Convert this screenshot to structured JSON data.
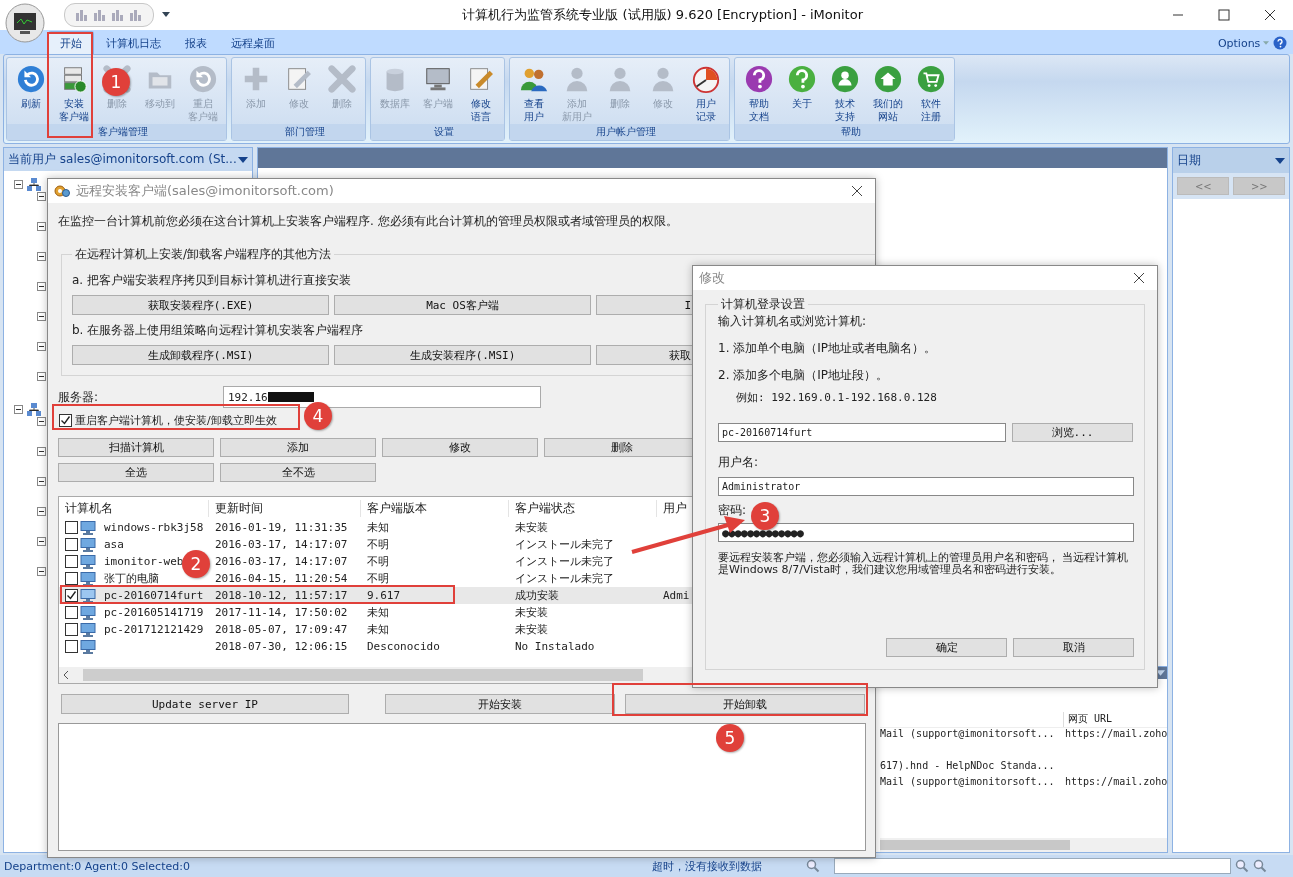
{
  "window": {
    "title": "计算机行为监管系统专业版 (试用版) 9.620 [Encryption] - iMonitor"
  },
  "tabs": [
    {
      "label": "开始",
      "selected": true
    },
    {
      "label": "计算机日志",
      "selected": false
    },
    {
      "label": "报表",
      "selected": false
    },
    {
      "label": "远程桌面",
      "selected": false
    }
  ],
  "options_menu": {
    "label": "Options"
  },
  "ribbon": [
    {
      "label": "客户端管理",
      "buttons": [
        {
          "label": "刷新",
          "disabled": false
        },
        {
          "label": "安装客户端",
          "disabled": false
        },
        {
          "label": "删除",
          "disabled": true
        },
        {
          "label": "移动到",
          "disabled": true
        },
        {
          "label": "重启客户端",
          "disabled": true
        }
      ]
    },
    {
      "label": "部门管理",
      "buttons": [
        {
          "label": "添加",
          "disabled": true
        },
        {
          "label": "修改",
          "disabled": true
        },
        {
          "label": "删除",
          "disabled": true
        }
      ]
    },
    {
      "label": "设置",
      "buttons": [
        {
          "label": "数据库",
          "disabled": true
        },
        {
          "label": "客户端",
          "disabled": true
        },
        {
          "label": "修改语言",
          "disabled": false
        }
      ]
    },
    {
      "label": "用户帐户管理",
      "buttons": [
        {
          "label": "查看用户",
          "disabled": false
        },
        {
          "label": "添加新用户",
          "disabled": true
        },
        {
          "label": "删除",
          "disabled": true
        },
        {
          "label": "修改",
          "disabled": true
        },
        {
          "label": "用户记录",
          "disabled": false
        }
      ]
    },
    {
      "label": "帮助",
      "buttons": [
        {
          "label": "帮助文档",
          "disabled": false
        },
        {
          "label": "关于",
          "disabled": false
        },
        {
          "label": "技术支持",
          "disabled": false
        },
        {
          "label": "我们的网站",
          "disabled": false
        },
        {
          "label": "软件注册",
          "disabled": false
        }
      ]
    }
  ],
  "current_user": "当前用户 sales@imonitorsoft.com (St...",
  "log_pane": {
    "column": "网页 URL",
    "rows": [
      {
        "column_1": "Mail (support@imonitorsoft...",
        "url": "https://mail.zoho"
      },
      {},
      {
        "column_1": "617).hnd - HelpNDoc Standa..."
      },
      {
        "column_1": "Mail (support@imonitorsoft...",
        "url": "https://mail.zoho"
      }
    ]
  },
  "date_panel": {
    "title": "日期",
    "prev": "<<",
    "next": ">>"
  },
  "status_bar": {
    "counts": "Department:0 Agent:0 Selected:0",
    "message": "超时，没有接收到数据"
  },
  "install_dialog": {
    "title": "远程安装客户端(sales@imonitorsoft.com)",
    "intro": "在监控一台计算机前您必须在这台计算机上安装客户端程序. 您必须有此台计算机的管理员权限或者域管理员的权限。",
    "group_title": "在远程计算机上安装/卸载客户端程序的其他方法",
    "method_a": "a. 把客户端安装程序拷贝到目标计算机进行直接安装",
    "method_a_buttons": [
      "获取安装程序(.EXE)",
      "Mac OS客户端",
      "I"
    ],
    "method_b": "b. 在服务器上使用组策略向远程计算机安装客户端程序",
    "method_b_buttons": [
      "生成卸载程序(.MSI)",
      "生成安装程序(.MSI)",
      "获取"
    ],
    "server_label": "服务器:",
    "server_value": "192.16",
    "restart": {
      "label": "重启客户端计算机，使安装/卸载立即生效",
      "checked": true
    },
    "action_buttons": [
      "扫描计算机",
      "添加",
      "修改",
      "删除"
    ],
    "select_buttons": [
      "全选",
      "全不选"
    ],
    "table": {
      "columns": [
        "计算机名",
        "更新时间",
        "客户端版本",
        "客户端状态",
        "用户"
      ],
      "rows": [
        {
          "checked": false,
          "selected": false,
          "name": "windows-rbk3j58",
          "updated": "2016-01-19, 11:31:35",
          "version": "未知",
          "status": "未安装"
        },
        {
          "checked": false,
          "selected": false,
          "name": "asa",
          "updated": "2016-03-17, 14:17:07",
          "version": "不明",
          "status": "インストール未完了"
        },
        {
          "checked": false,
          "selected": false,
          "name": "imonitor-web",
          "updated": "2016-03-17, 14:17:07",
          "version": "不明",
          "status": "インストール未完了"
        },
        {
          "checked": false,
          "selected": false,
          "name": "张丁的电脑",
          "updated": "2016-04-15, 11:20:54",
          "version": "不明",
          "status": "インストール未完了"
        },
        {
          "checked": true,
          "selected": true,
          "name": "pc-20160714furt",
          "updated": "2018-10-12, 11:57:17",
          "version": "9.617",
          "status": "成功安装",
          "user": "Admi"
        },
        {
          "checked": false,
          "selected": false,
          "name": "pc-201605141719",
          "updated": "2017-11-14, 17:50:02",
          "version": "未知",
          "status": "未安装"
        },
        {
          "checked": false,
          "selected": false,
          "name": "pc-201712121429",
          "updated": "2018-05-07, 17:09:47",
          "version": "未知",
          "status": "未安装"
        },
        {
          "checked": false,
          "selected": false,
          "updated": "2018-07-30, 12:06:15",
          "version": "Desconocido",
          "status": "No Instalado"
        }
      ]
    },
    "bottom_buttons": [
      "Update server IP",
      "开始安装",
      "开始卸载"
    ]
  },
  "edit_dialog": {
    "title": "修改",
    "group_title": "计算机登录设置",
    "prompt": "输入计算机名或浏览计算机:",
    "hint_1": "1. 添加单个电脑（IP地址或者电脑名）。",
    "hint_2": "2. 添加多个电脑（IP地址段）。",
    "example": "例如: 192.169.0.1-192.168.0.128",
    "computer_value": "pc-20160714furt",
    "browse": "浏览...",
    "username_label": "用户名:",
    "username_value": "Administrator",
    "password_label": "密码:",
    "password_value": "●●●●●●●●●●●●●",
    "note": "要远程安装客户端，您必须输入远程计算机上的管理员用户名和密码， 当远程计算机是Windows 8/7/Vista时，我们建议您用域管理员名和密码进行安装。",
    "buttons": [
      "确定",
      "取消"
    ]
  },
  "annotations": [
    {
      "label": "1"
    },
    {
      "label": "2"
    },
    {
      "label": "3"
    },
    {
      "label": "4"
    },
    {
      "label": "5"
    }
  ]
}
